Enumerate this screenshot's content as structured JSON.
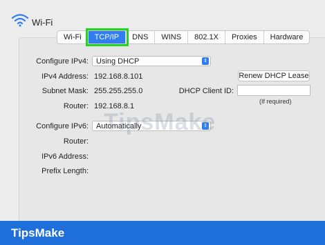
{
  "window": {
    "title": "Wi-Fi"
  },
  "tabs": [
    {
      "label": "Wi-Fi"
    },
    {
      "label": "TCP/IP"
    },
    {
      "label": "DNS"
    },
    {
      "label": "WINS"
    },
    {
      "label": "802.1X"
    },
    {
      "label": "Proxies"
    },
    {
      "label": "Hardware"
    }
  ],
  "ipv4": {
    "configure_label": "Configure IPv4:",
    "configure_value": "Using DHCP",
    "address_label": "IPv4 Address:",
    "address_value": "192.168.8.101",
    "subnet_label": "Subnet Mask:",
    "subnet_value": "255.255.255.0",
    "router_label": "Router:",
    "router_value": "192.168.8.1",
    "renew_button": "Renew DHCP Lease",
    "client_id_label": "DHCP Client ID:",
    "client_id_value": "",
    "client_id_hint": "(If required)"
  },
  "ipv6": {
    "configure_label": "Configure IPv6:",
    "configure_value": "Automatically",
    "router_label": "Router:",
    "address_label": "IPv6 Address:",
    "prefix_label": "Prefix Length:"
  },
  "watermark": "TipsMake",
  "footer": {
    "brand": "TipsMake"
  },
  "colors": {
    "accent": "#2f7df0",
    "highlight": "#22d61c",
    "footer": "#1e6fd9"
  }
}
